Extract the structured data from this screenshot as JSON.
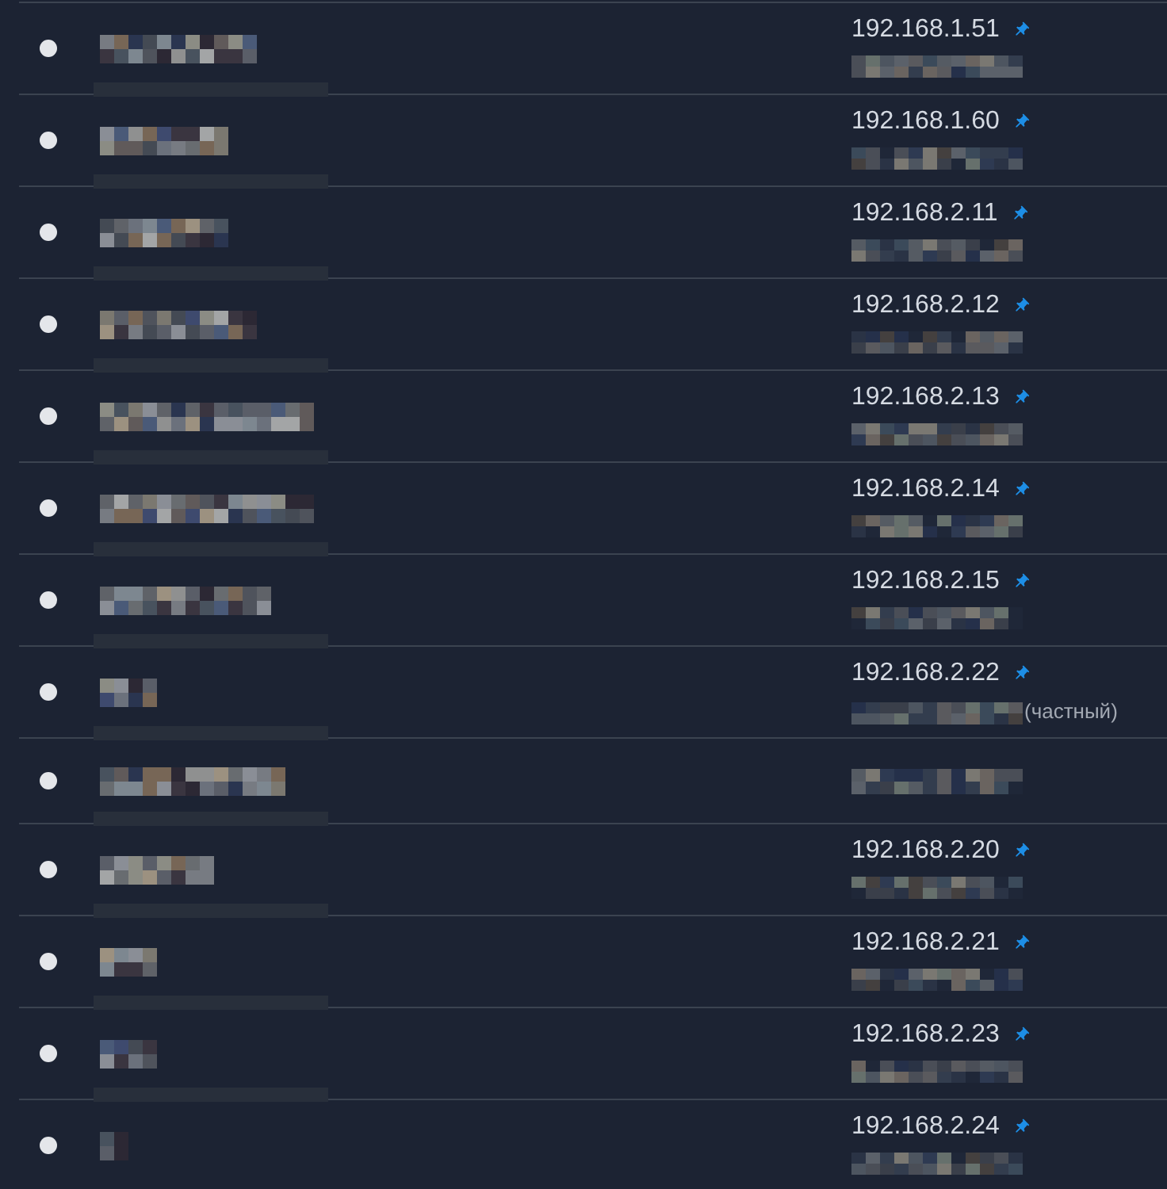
{
  "devices": [
    {
      "address": "192.168.1.51",
      "pinned": true
    },
    {
      "address": "192.168.1.60",
      "pinned": true
    },
    {
      "address": "192.168.2.11",
      "pinned": true
    },
    {
      "address": "192.168.2.12",
      "pinned": true
    },
    {
      "address": "192.168.2.13",
      "pinned": true
    },
    {
      "address": "192.168.2.14",
      "pinned": true
    },
    {
      "address": "192.168.2.15",
      "pinned": true
    },
    {
      "address": "192.168.2.22",
      "pinned": true,
      "note": "(частный)"
    },
    {
      "pinned": false
    },
    {
      "address": "192.168.2.20",
      "pinned": true
    },
    {
      "address": "192.168.2.21",
      "pinned": true
    },
    {
      "address": "192.168.2.23",
      "pinned": true
    },
    {
      "address": "192.168.2.24",
      "pinned": true
    }
  ]
}
